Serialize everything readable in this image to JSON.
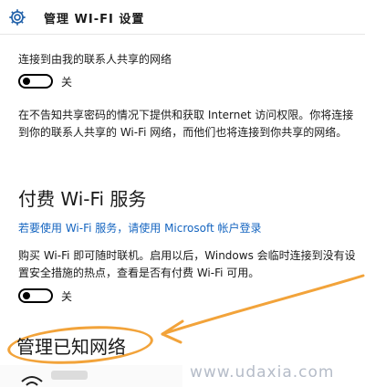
{
  "header": {
    "title": "管理 WI-FI 设置",
    "icon": "gear-icon"
  },
  "share_contacts": {
    "label": "连接到由我的联系人共享的网络",
    "toggle_state": "关",
    "description": "在不告知共享密码的情况下提供和获取 Internet 访问权限。你将连接到你的联系人共享的 Wi-Fi 网络，而他们也将连接到你共享的网络。"
  },
  "paid_wifi": {
    "heading": "付费 Wi-Fi 服务",
    "link": "若要使用 Wi-Fi 服务，请使用 Microsoft 帐户登录",
    "description": "购买 Wi-Fi 即可随时联机。启用以后，Windows 会临时连接到没有设置安全措施的热点，查看是否有付费 Wi-Fi 可用。",
    "toggle_state": "关"
  },
  "known_networks": {
    "heading": "管理已知网络"
  },
  "watermark": "www.udaxia.com",
  "colors": {
    "link": "#1565c0",
    "annotation": "#f2a33a"
  }
}
